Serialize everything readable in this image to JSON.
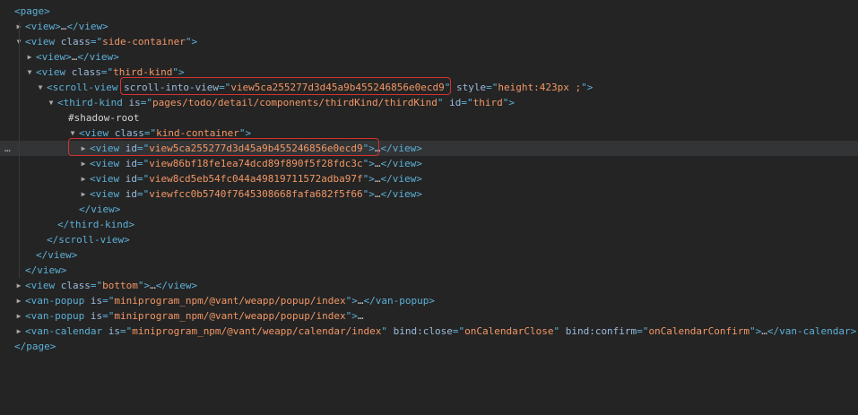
{
  "rows": [
    {
      "parts": [
        [
          "tag",
          "<page>"
        ]
      ]
    },
    {
      "parts": [
        [
          "tag",
          "<view>"
        ],
        [
          "ell",
          "…"
        ],
        [
          "tag",
          "</view>"
        ]
      ]
    },
    {
      "parts": [
        [
          "tag",
          "<view "
        ],
        [
          "attr",
          "class"
        ],
        [
          "tag",
          "=\""
        ],
        [
          "val",
          "side-container"
        ],
        [
          "tag",
          "\">"
        ]
      ]
    },
    {
      "parts": [
        [
          "tag",
          "<view>"
        ],
        [
          "ell",
          "…"
        ],
        [
          "tag",
          "</view>"
        ]
      ]
    },
    {
      "parts": [
        [
          "tag",
          "<view "
        ],
        [
          "attr",
          "class"
        ],
        [
          "tag",
          "=\""
        ],
        [
          "val",
          "third-kind"
        ],
        [
          "tag",
          "\">"
        ]
      ]
    },
    {
      "parts": [
        [
          "tag",
          "<scroll-view "
        ],
        [
          "attr",
          "scroll-into-view"
        ],
        [
          "tag",
          "=\""
        ],
        [
          "val",
          "view5ca255277d3d45a9b455246856e0ecd9"
        ],
        [
          "tag",
          "\" "
        ],
        [
          "attr",
          "style"
        ],
        [
          "tag",
          "=\""
        ],
        [
          "val",
          "height:423px ;"
        ],
        [
          "tag",
          "\">"
        ]
      ]
    },
    {
      "parts": [
        [
          "tag",
          "<third-kind "
        ],
        [
          "attr",
          "is"
        ],
        [
          "tag",
          "=\""
        ],
        [
          "val",
          "pages/todo/detail/components/thirdKind/thirdKind"
        ],
        [
          "tag",
          "\" "
        ],
        [
          "attr",
          "id"
        ],
        [
          "tag",
          "=\""
        ],
        [
          "val",
          "third"
        ],
        [
          "tag",
          "\">"
        ]
      ]
    },
    {
      "parts": [
        [
          "txtc",
          "#shadow-root"
        ]
      ]
    },
    {
      "parts": [
        [
          "tag",
          "<view "
        ],
        [
          "attr",
          "class"
        ],
        [
          "tag",
          "=\""
        ],
        [
          "val",
          "kind-container"
        ],
        [
          "tag",
          "\">"
        ]
      ]
    },
    {
      "parts": [
        [
          "tag",
          "<view "
        ],
        [
          "attr",
          "id"
        ],
        [
          "tag",
          "=\""
        ],
        [
          "val",
          "view5ca255277d3d45a9b455246856e0ecd9"
        ],
        [
          "tag",
          "\">"
        ],
        [
          "ell",
          "…"
        ],
        [
          "tag",
          "</view>"
        ]
      ]
    },
    {
      "parts": [
        [
          "tag",
          "<view "
        ],
        [
          "attr",
          "id"
        ],
        [
          "tag",
          "=\""
        ],
        [
          "val",
          "view86bf18fe1ea74dcd89f890f5f28fdc3c"
        ],
        [
          "tag",
          "\">"
        ],
        [
          "ell",
          "…"
        ],
        [
          "tag",
          "</view>"
        ]
      ]
    },
    {
      "parts": [
        [
          "tag",
          "<view "
        ],
        [
          "attr",
          "id"
        ],
        [
          "tag",
          "=\""
        ],
        [
          "val",
          "view8cd5eb54fc044a49819711572adba97f"
        ],
        [
          "tag",
          "\">"
        ],
        [
          "ell",
          "…"
        ],
        [
          "tag",
          "</view>"
        ]
      ]
    },
    {
      "parts": [
        [
          "tag",
          "<view "
        ],
        [
          "attr",
          "id"
        ],
        [
          "tag",
          "=\""
        ],
        [
          "val",
          "viewfcc0b5740f7645308668fafa682f5f66"
        ],
        [
          "tag",
          "\">"
        ],
        [
          "ell",
          "…"
        ],
        [
          "tag",
          "</view>"
        ]
      ]
    },
    {
      "parts": [
        [
          "tag",
          "</view>"
        ]
      ]
    },
    {
      "parts": [
        [
          "tag",
          "</third-kind>"
        ]
      ]
    },
    {
      "parts": [
        [
          "tag",
          "</scroll-view>"
        ]
      ]
    },
    {
      "parts": [
        [
          "tag",
          "</view>"
        ]
      ]
    },
    {
      "parts": [
        [
          "tag",
          "</view>"
        ]
      ]
    },
    {
      "parts": [
        [
          "tag",
          "<view "
        ],
        [
          "attr",
          "class"
        ],
        [
          "tag",
          "=\""
        ],
        [
          "val",
          "bottom"
        ],
        [
          "tag",
          "\">"
        ],
        [
          "ell",
          "…"
        ],
        [
          "tag",
          "</view>"
        ]
      ]
    },
    {
      "parts": [
        [
          "tag",
          "<van-popup "
        ],
        [
          "attr",
          "is"
        ],
        [
          "tag",
          "=\""
        ],
        [
          "val",
          "miniprogram_npm/@vant/weapp/popup/index"
        ],
        [
          "tag",
          "\">"
        ],
        [
          "ell",
          "…"
        ],
        [
          "tag",
          "</van-popup>"
        ]
      ]
    },
    {
      "parts": [
        [
          "tag",
          "<van-popup "
        ],
        [
          "attr",
          "is"
        ],
        [
          "tag",
          "=\""
        ],
        [
          "val",
          "miniprogram_npm/@vant/weapp/popup/index"
        ],
        [
          "tag",
          "\">"
        ],
        [
          "ell",
          "…"
        ]
      ]
    },
    {
      "parts": [
        [
          "tag",
          "<van-calendar "
        ],
        [
          "attr",
          "is"
        ],
        [
          "tag",
          "=\""
        ],
        [
          "val",
          "miniprogram_npm/@vant/weapp/calendar/index"
        ],
        [
          "tag",
          "\" "
        ],
        [
          "attr",
          "bind:close"
        ],
        [
          "tag",
          "=\""
        ],
        [
          "val",
          "onCalendarClose"
        ],
        [
          "tag",
          "\" "
        ],
        [
          "attr",
          "bind:confirm"
        ],
        [
          "tag",
          "=\""
        ],
        [
          "val",
          "onCalendarConfirm"
        ],
        [
          "tag",
          "\">"
        ],
        [
          "ell",
          "…"
        ],
        [
          "tag",
          "</van-calendar>"
        ]
      ]
    },
    {
      "parts": [
        [
          "tag",
          "</page>"
        ]
      ]
    }
  ],
  "selected_dots": "…",
  "icons": {
    "collapsed": "triangle-right-icon",
    "expanded": "triangle-down-icon"
  }
}
